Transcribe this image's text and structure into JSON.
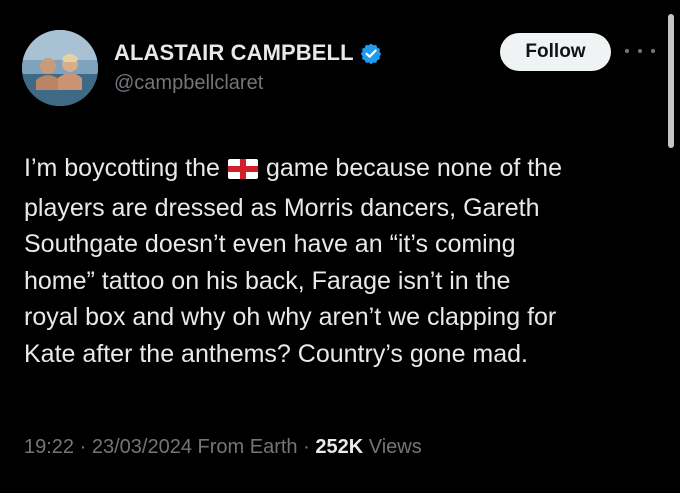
{
  "author": {
    "display_name": "ALASTAIR CAMPBELL",
    "handle": "@campbellclaret",
    "verified": true
  },
  "actions": {
    "follow_label": "Follow",
    "more_icon": "more-horizontal-icon"
  },
  "tweet": {
    "line1_before_flag": "I’m boycotting the",
    "flag_icon": "england-flag-icon",
    "line1_after_flag": "game because none of the",
    "line2": "players are dressed as Morris dancers, Gareth",
    "line3": "Southgate doesn’t even have an “it’s coming",
    "line4": "home” tattoo on his back, Farage isn’t in the",
    "line5": "royal box and why oh why aren’t we clapping for",
    "line6": "Kate after the anthems? Country’s gone mad."
  },
  "meta": {
    "time": "19:22",
    "separator": "·",
    "date": "23/03/2024",
    "source": "From Earth",
    "views_count": "252K",
    "views_label": "Views"
  },
  "colors": {
    "background": "#000000",
    "text_primary": "#e7e9ea",
    "text_secondary": "#71767b",
    "verified_blue": "#1d9bf0",
    "follow_bg": "#eff3f4"
  }
}
